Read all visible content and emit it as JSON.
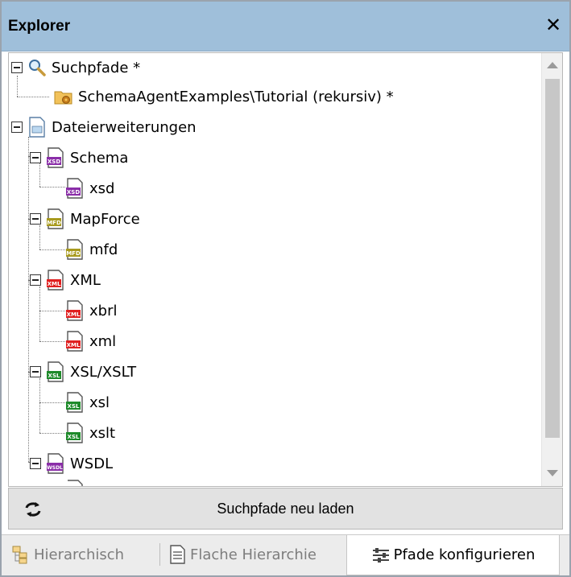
{
  "panel": {
    "title": "Explorer",
    "close_glyph": "✕"
  },
  "tree": [
    {
      "label": "Suchpfade *",
      "icon": "search-icon",
      "kind": "toggle"
    },
    {
      "label": "SchemaAgentExamples\\Tutorial (rekursiv) *",
      "icon": "folder-icon"
    },
    {
      "label": "Dateierweiterungen",
      "icon": "file-group-icon",
      "kind": "toggle"
    },
    {
      "label": "Schema",
      "icon": "xsd-file-icon",
      "badge": "XSD",
      "color": "#8a2da8",
      "kind": "toggle"
    },
    {
      "label": "xsd",
      "icon": "xsd-file-icon",
      "badge": "XSD",
      "color": "#8a2da8"
    },
    {
      "label": "MapForce",
      "icon": "mfd-file-icon",
      "badge": "MFD",
      "color": "#a89a1e",
      "kind": "toggle"
    },
    {
      "label": "mfd",
      "icon": "mfd-file-icon",
      "badge": "MFD",
      "color": "#a89a1e"
    },
    {
      "label": "XML",
      "icon": "xml-file-icon",
      "badge": "XML",
      "color": "#e02020",
      "kind": "toggle"
    },
    {
      "label": "xbrl",
      "icon": "xml-file-icon",
      "badge": "XML",
      "color": "#e02020"
    },
    {
      "label": "xml",
      "icon": "xml-file-icon",
      "badge": "XML",
      "color": "#e02020"
    },
    {
      "label": "XSL/XSLT",
      "icon": "xsl-file-icon",
      "badge": "XSL",
      "color": "#1e8a2a",
      "kind": "toggle"
    },
    {
      "label": "xsl",
      "icon": "xsl-file-icon",
      "badge": "XSL",
      "color": "#1e8a2a"
    },
    {
      "label": "xslt",
      "icon": "xsl-file-icon",
      "badge": "XSL",
      "color": "#1e8a2a"
    },
    {
      "label": "WSDL",
      "icon": "wsdl-file-icon",
      "badge": "WSDL",
      "color": "#8a2da8",
      "kind": "toggle"
    }
  ],
  "reload_button": {
    "label": "Suchpfade neu laden",
    "icon": "refresh-icon"
  },
  "tabs": [
    {
      "label": "Hierarchisch",
      "icon": "hierarchy-icon",
      "active": false
    },
    {
      "label": "Flache Hierarchie",
      "icon": "document-icon",
      "active": false
    },
    {
      "label": "Pfade konfigurieren",
      "icon": "settings-sliders-icon",
      "active": true
    }
  ]
}
